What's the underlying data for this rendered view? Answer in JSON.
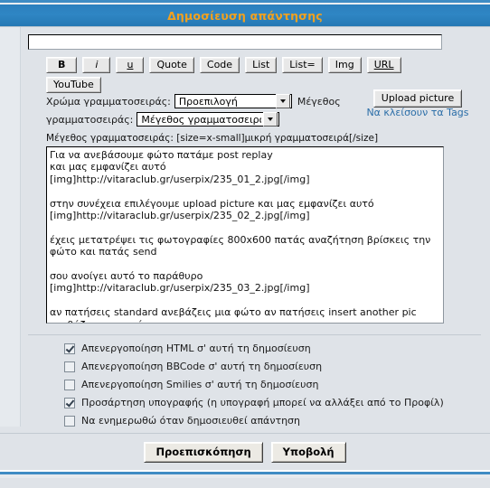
{
  "window": {
    "title": "Δημοσίευση απάντησης"
  },
  "subject": {
    "value": "",
    "placeholder": ""
  },
  "toolbar": {
    "buttons": [
      {
        "label": "B",
        "name": "bold-button"
      },
      {
        "label": "i",
        "name": "italic-button"
      },
      {
        "label": "u",
        "name": "underline-button"
      },
      {
        "label": "Quote",
        "name": "quote-button"
      },
      {
        "label": "Code",
        "name": "code-button"
      },
      {
        "label": "List",
        "name": "list-button"
      },
      {
        "label": "List=",
        "name": "ordered-list-button"
      },
      {
        "label": "Img",
        "name": "image-button"
      },
      {
        "label": "URL",
        "name": "url-button"
      }
    ],
    "youtube_label": "YouTube"
  },
  "font_controls": {
    "color_label": "Χρώμα γραμματοσειράς:",
    "color_value": "Προεπιλογή",
    "size_label_part1": "Μέγεθος",
    "size_label_part2": "γραμματοσειράς:",
    "size_value": "Μέγεθος γραμματοσειράς",
    "upload_button": "Upload picture",
    "tags_link": "Να κλείσουν τα Tags",
    "hint": "Μέγεθος γραμματοσειράς: [size=x-small]μικρή γραμματοσειρά[/size]"
  },
  "message": {
    "value": "Για να ανεβάσουμε φώτο πατάμε post replay\nκαι μας εμφανίζει αυτό\n[img]http://vitaraclub.gr/userpix/235_01_2.jpg[/img]\n\nστην συνέχεια επιλέγουμε upload picture και μας εμφανίζει αυτό\n[img]http://vitaraclub.gr/userpix/235_02_2.jpg[/img]\n\nέχεις μετατρέψει τις φωτογραφίες 800x600 πατάς αναζήτηση βρίσκεις την φώτο και πατάς send\n\nσου ανοίγει αυτό το παράθυρο [img]http://vitaraclub.gr/userpix/235_03_2.jpg[/img]\n\nαν πατήσεις standard ανεβάζεις μια φώτο αν πατήσεις insert another pic ανεβάζεις περισσότερες"
  },
  "options": [
    {
      "label": "Απενεργοποίηση HTML σ' αυτή τη δημοσίευση",
      "checked": true,
      "name": "option-disable-html"
    },
    {
      "label": "Απενεργοποίηση BBCode σ' αυτή τη δημοσίευση",
      "checked": false,
      "name": "option-disable-bbcode"
    },
    {
      "label": "Απενεργοποίηση Smilies σ' αυτή τη δημοσίευση",
      "checked": false,
      "name": "option-disable-smilies"
    },
    {
      "label": "Προσάρτηση υπογραφής (η υπογραφή μπορεί να αλλάξει από το Προφίλ)",
      "checked": true,
      "name": "option-attach-signature"
    },
    {
      "label": "Να ενημερωθώ όταν δημοσιευθεί απάντηση",
      "checked": false,
      "name": "option-notify-reply"
    }
  ],
  "footer": {
    "preview_label": "Προεπισκόπηση",
    "submit_label": "Υποβολή"
  },
  "colors": {
    "title_text": "#f2a11e",
    "titlebar": "#2f86c4",
    "link": "#2b6ea8",
    "page_bg": "#dfe3e8"
  }
}
